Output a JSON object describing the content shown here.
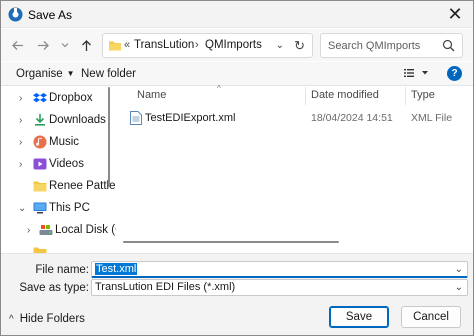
{
  "window": {
    "title": "Save As"
  },
  "address": {
    "overflow": "«",
    "segments": [
      "TransLution",
      "QMImports"
    ]
  },
  "search": {
    "placeholder": "Search QMImports"
  },
  "toolbar": {
    "organise": "Organise",
    "new_folder": "New folder"
  },
  "nav": {
    "items": [
      {
        "label": "Dropbox",
        "icon": "dropbox-icon"
      },
      {
        "label": "Downloads",
        "icon": "downloads-icon"
      },
      {
        "label": "Music",
        "icon": "music-icon"
      },
      {
        "label": "Videos",
        "icon": "videos-icon"
      },
      {
        "label": "Renee Pattle",
        "icon": "folder-icon"
      },
      {
        "label": "This PC",
        "icon": "pc-icon"
      },
      {
        "label": "Local Disk (C",
        "icon": "disk-icon"
      }
    ]
  },
  "columns": {
    "name": "Name",
    "date": "Date modified",
    "type": "Type"
  },
  "files": [
    {
      "name": "TestEDIExport.xml",
      "date": "18/04/2024 14:51",
      "type": "XML File"
    }
  ],
  "form": {
    "file_name_label": "File name:",
    "file_name_value": "Test.xml",
    "save_type_label": "Save as type:",
    "save_type_value": "TransLution EDI Files (*.xml)"
  },
  "buttons": {
    "hide_folders": "Hide Folders",
    "save": "Save",
    "cancel": "Cancel"
  },
  "colors": {
    "accent": "#0067c0",
    "selection": "#0078d7",
    "folder": "#f4c542"
  }
}
